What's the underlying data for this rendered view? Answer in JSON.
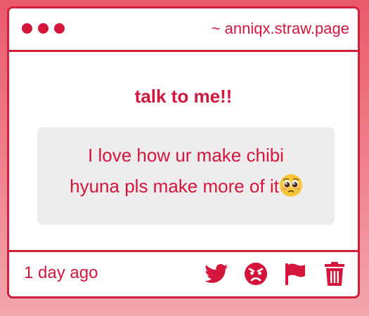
{
  "window": {
    "url": "~ anniqx.straw.page"
  },
  "post": {
    "heading": "talk to me!!",
    "message_line1": "I love how ur make chibi",
    "message_line2": "hyuna pls make more of it",
    "emoji": "pleading-face-emoji"
  },
  "footer": {
    "time": "1 day ago",
    "actions": [
      "twitter-icon",
      "angry-face-icon",
      "flag-icon",
      "trash-icon"
    ]
  },
  "colors": {
    "accent": "#d4163c",
    "border": "#d3203a",
    "message_bg": "#eeeced"
  }
}
